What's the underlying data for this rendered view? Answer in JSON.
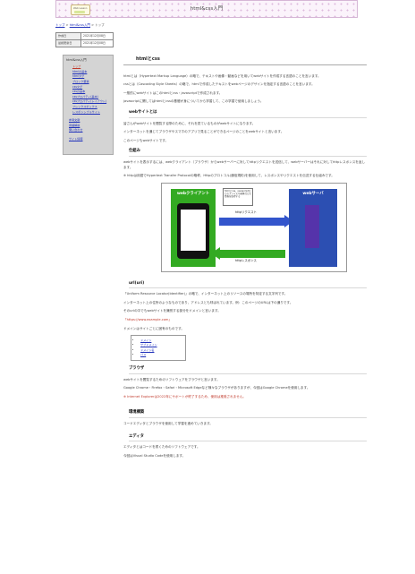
{
  "header": {
    "logo_text": "Web Lesson",
    "title": "html&css入門"
  },
  "breadcrumb": {
    "items": [
      "トップ",
      "html&css入門"
    ],
    "current": "トップ",
    "sep": ">"
  },
  "dates": {
    "rows": [
      {
        "label": "作成日",
        "value": "2021年12月08日"
      },
      {
        "label": "最終更新日",
        "value": "2021年12月08日"
      }
    ]
  },
  "sidebar": {
    "title": "html&css入門",
    "items": [
      "トップ",
      "htmlの基本",
      "htmlタグ",
      "ブロック要素",
      "cssタグ",
      "cssの基本",
      "cssプロパティ(基本)",
      "cssプロパティ(レイアウト)",
      "フレックスボックス",
      "レスポンシブルサイト"
    ],
    "items2": [
      "参考文献",
      "用語解説",
      "問い合わせ"
    ],
    "items3": [
      "サイト情報"
    ]
  },
  "main": {
    "h2": "htmlとcss",
    "intro": [
      "htmlとは（Hypertext Markup Language）の略で、テキストや画像・動画などを用いてwebサイトを作成する言語のことを言います。",
      "cssとは（Cascading Style Sheets）の略で、htmlで作成したテキストをwebページのデザインを指定する言語のことを言います。",
      "一般的にwebサイトはこのhtmlとcss・javascriptで作成されます。",
      "javascriptに関してはhtmlとcssの基礎が身についてから学習して、この学習で使用しましょう。"
    ],
    "h3_site": "webサイトとは",
    "site_text": [
      "皆さんがwebサイトを閲覧する際のために、それを見ているものがwebサイトになります。",
      "インターネットを通じてブラウザやスマホのアプリで見ることができるページのことをwebサイトと言います。",
      "このページもwebサイトです。"
    ],
    "h3_mech": "仕組み",
    "mech_text": [
      "webサイトを表示するには、webクライアント（ブラウザ）からwebサーバーに対してhttpリクエストを送信して、webサーバーはそれに対してhttpレスポンスを返します。",
      "※ httpは用語でHypertext Transfer Protocolの略称、Httpのプロトコル(通信規約)を使用して、レスポンスやリクエストを伝送する仕組みです。"
    ],
    "diagram": {
      "client": "webクライアント",
      "server": "webサーバ",
      "note": "htmlとcss、javascriptなどのファイルや画像などの情報を取得する",
      "req": "httpリクエスト",
      "res": "httpレスポンス"
    },
    "h3_url": "url(uri)",
    "url_text": [
      "「Uniform Resource Locator(Identifier)」の略で、インターネット上のリソースの場所を特定する文字列です。",
      "インターネット上の住所のようなものであり、アドレスとも呼ばれています。例：このページのURLは下の通りです。",
      "そのurlの中でもwebサイトを識別する部分をドメインと言います。",
      "「https://www.example.com」",
      "ドメインはサイトごとに固有のものです。"
    ],
    "url_links": [
      "ドメイン",
      "サブドメイン",
      "ドメイン名",
      "パス"
    ],
    "h3_browser": "ブラウザ",
    "browser_text": [
      "webサイトを閲覧するためのソフトウェアをブラウザと言います。",
      "Google Chrome・Firefox・Safari・Microsoft Edgeなど様々なブラウザがありますが、今回はGoogle Chromeを使用します。",
      "※ Internet Explorerは2022年にサポートが終了するため、使用は推奨されません。"
    ],
    "h3_env": "環境構築",
    "env_text": "コードエディタとブラウザを使用して学習を進めていきます。",
    "h3_editor": "エディタ",
    "editor_text": [
      "エディタとはコードを書くためのソフトウェアです。",
      "今回はVisual Studio Codeを使用します。"
    ]
  }
}
